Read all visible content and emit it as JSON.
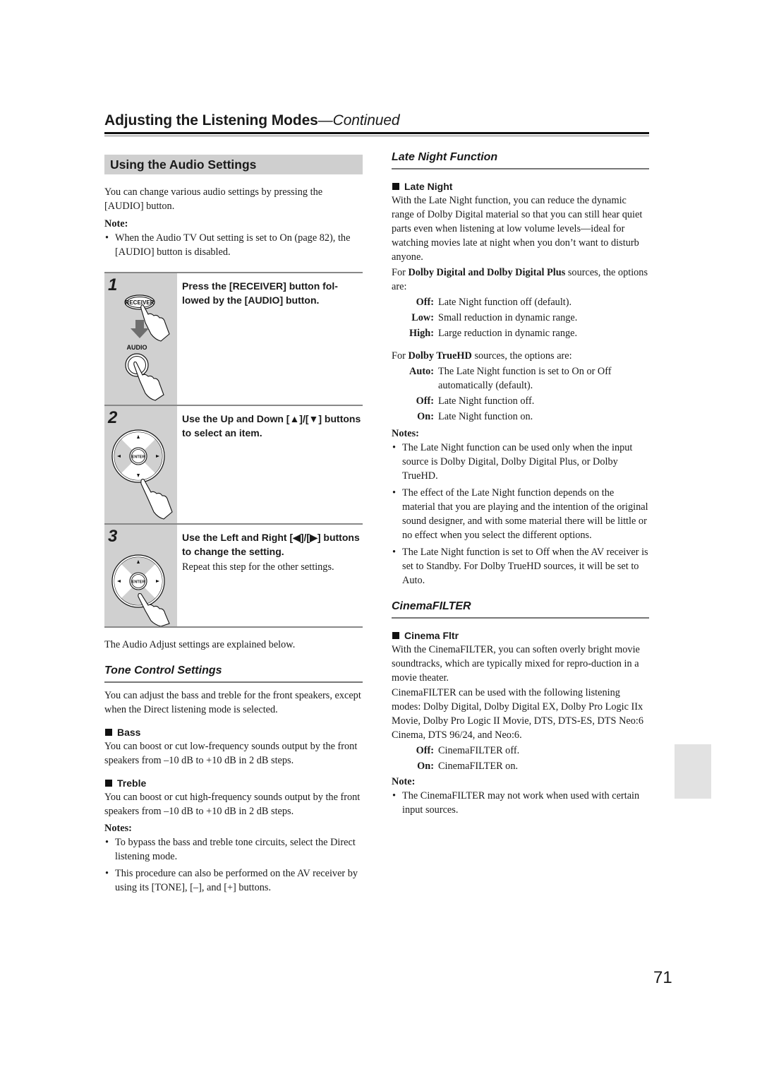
{
  "header": {
    "title": "Adjusting the Listening Modes",
    "title_suffix": "—Continued"
  },
  "left": {
    "section_title": "Using the Audio Settings",
    "intro": "You can change various audio settings by pressing the [AUDIO] button.",
    "note_label": "Note:",
    "notes": [
      "When the Audio TV Out setting is set to On (page 82), the [AUDIO] button is disabled."
    ],
    "steps": [
      {
        "number": "1",
        "instruction": "Press the [RECEIVER] button fol-lowed by the [AUDIO] button.",
        "detail": "",
        "icon": "receiver-then-audio-button-press",
        "button_labels": [
          "RECEIVER",
          "AUDIO"
        ]
      },
      {
        "number": "2",
        "instruction": "Use the Up and Down [▲]/[▼] buttons to select an item.",
        "detail": "",
        "icon": "dpad-up-down-press",
        "button_labels": [
          "ENTER"
        ]
      },
      {
        "number": "3",
        "instruction": "Use the Left and Right [◀]/[▶] buttons to change the setting.",
        "detail": "Repeat this step for the other settings.",
        "icon": "dpad-left-right-press",
        "button_labels": [
          "ENTER"
        ]
      }
    ],
    "after_steps": "The Audio Adjust settings are explained below.",
    "tone": {
      "heading": "Tone Control Settings",
      "intro": "You can adjust the bass and treble for the front speakers, except when the Direct listening mode is selected.",
      "bass_heading": "Bass",
      "bass_text": "You can boost or cut low-frequency sounds output by the front speakers from –10 dB to +10 dB in 2 dB steps.",
      "treble_heading": "Treble",
      "treble_text": "You can boost or cut high-frequency sounds output by the front speakers from –10 dB to +10 dB in 2 dB steps.",
      "notes_label": "Notes:",
      "notes": [
        "To bypass the bass and treble tone circuits, select the Direct listening mode.",
        "This procedure can also be performed on the AV receiver by using its [TONE], [–], and [+] buttons."
      ]
    }
  },
  "right": {
    "late_night": {
      "heading": "Late Night Function",
      "item_heading": "Late Night",
      "intro": "With the Late Night function, you can reduce the dynamic range of Dolby Digital material so that you can still hear quiet parts even when listening at low volume levels—ideal for watching movies late at night when you don’t want to disturb anyone.",
      "dd_prefix": "For ",
      "dd_bold": "Dolby Digital and Dolby Digital Plus",
      "dd_suffix": " sources, the options are:",
      "dd_options": [
        {
          "key": "Off:",
          "value": "Late Night function off (default)."
        },
        {
          "key": "Low:",
          "value": "Small reduction in dynamic range."
        },
        {
          "key": "High:",
          "value": "Large reduction in dynamic range."
        }
      ],
      "thd_prefix": "For ",
      "thd_bold": "Dolby TrueHD",
      "thd_suffix": " sources, the options are:",
      "thd_options": [
        {
          "key": "Auto:",
          "value": "The Late Night function is set to On or Off automatically (default)."
        },
        {
          "key": "Off:",
          "value": "Late Night function off."
        },
        {
          "key": "On:",
          "value": "Late Night function on."
        }
      ],
      "notes_label": "Notes:",
      "notes": [
        "The Late Night function can be used only when the input source is Dolby Digital, Dolby Digital Plus, or Dolby TrueHD.",
        "The effect of the Late Night function depends on the material that you are playing and the intention of the original sound designer, and with some material there will be little or no effect when you select the different options.",
        "The Late Night function is set to Off when the AV receiver is set to Standby. For Dolby TrueHD sources, it will be set to Auto."
      ]
    },
    "cinema": {
      "heading": "CinemaFILTER",
      "item_heading": "Cinema Fltr",
      "intro": "With the CinemaFILTER, you can soften overly bright movie soundtracks, which are typically mixed for repro-duction in a movie theater.",
      "modes": "CinemaFILTER can be used with the following listening modes: Dolby Digital, Dolby Digital EX, Dolby Pro Logic IIx Movie, Dolby Pro Logic II Movie, DTS, DTS-ES, DTS Neo:6 Cinema, DTS 96/24, and Neo:6.",
      "options": [
        {
          "key": "Off:",
          "value": "CinemaFILTER off."
        },
        {
          "key": "On:",
          "value": "CinemaFILTER on."
        }
      ],
      "note_label": "Note:",
      "notes": [
        "The CinemaFILTER may not work when used with certain input sources."
      ]
    }
  },
  "page_number": "71"
}
